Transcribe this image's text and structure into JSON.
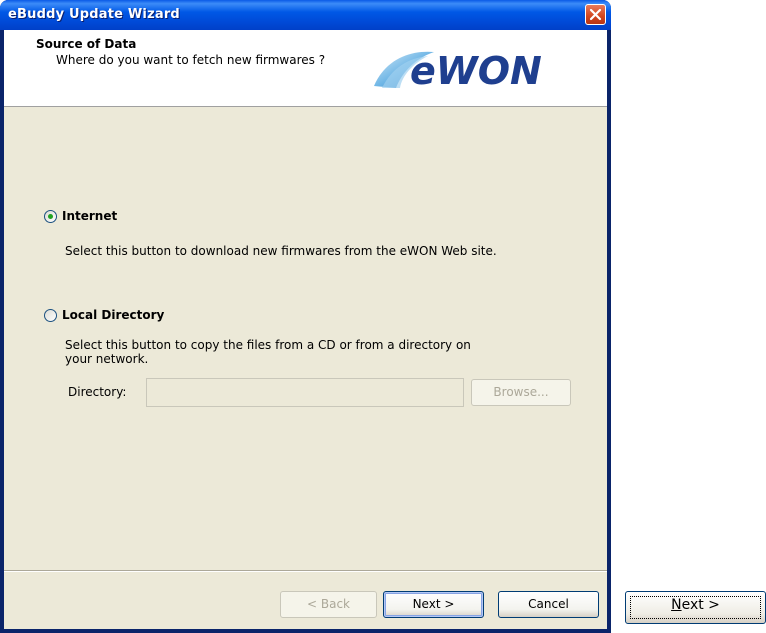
{
  "window": {
    "title": "eBuddy Update Wizard"
  },
  "header": {
    "title": "Source of Data",
    "subtitle": "Where do you want to fetch new firmwares ?",
    "logo_text": "eWON"
  },
  "options": {
    "internet": {
      "label": "Internet",
      "selected": true,
      "description": "Select this button to download new firmwares from the eWON Web site."
    },
    "local": {
      "label": "Local Directory",
      "selected": false,
      "description_line1": "Select this button to copy the files from a CD or from a directory on",
      "description_line2": "your network.",
      "directory_label": "Directory:",
      "directory_value": "",
      "browse_label": "Browse..."
    }
  },
  "footer": {
    "back_label": "< Back",
    "next_label": "Next >",
    "cancel_label": "Cancel"
  },
  "zoomed_button": {
    "label_mnemonic": "N",
    "label_rest": "ext >"
  },
  "colors": {
    "titlebar": "#0058e6",
    "dialog_bg": "#ece9d8",
    "radio_dot": "#21a121"
  }
}
